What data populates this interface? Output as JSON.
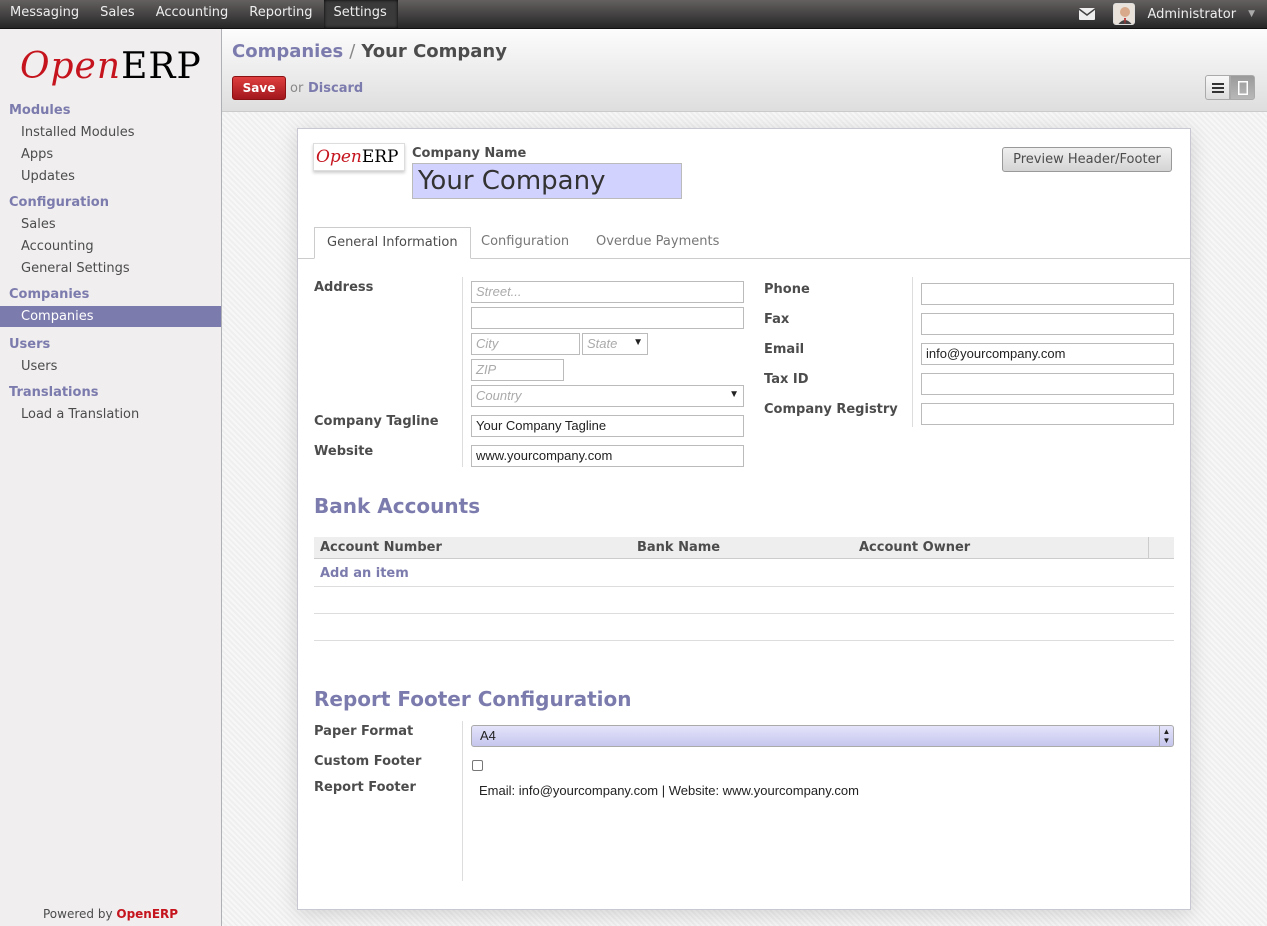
{
  "topbar": {
    "menu": [
      "Messaging",
      "Sales",
      "Accounting",
      "Reporting",
      "Settings"
    ],
    "active_menu": "Settings",
    "user": "Administrator"
  },
  "sidebar": {
    "powered_prefix": "Powered by ",
    "powered_brand": "OpenERP",
    "logo_open": "Open",
    "logo_erp": "ERP",
    "sections": [
      {
        "title": "Modules",
        "items": [
          "Installed Modules",
          "Apps",
          "Updates"
        ]
      },
      {
        "title": "Configuration",
        "items": [
          "Sales",
          "Accounting",
          "General Settings"
        ]
      },
      {
        "title": "Companies",
        "items": [
          "Companies"
        ]
      },
      {
        "title": "Users",
        "items": [
          "Users"
        ]
      },
      {
        "title": "Translations",
        "items": [
          "Load a Translation"
        ]
      }
    ]
  },
  "header": {
    "breadcrumb_parent": "Companies",
    "breadcrumb_sep": "/",
    "breadcrumb_current": "Your Company",
    "save_label": "Save",
    "or_text": "or",
    "discard_label": "Discard"
  },
  "form": {
    "company_name_label": "Company Name",
    "company_name_value": "Your Company",
    "preview_button": "Preview Header/Footer",
    "tabs": [
      "General Information",
      "Configuration",
      "Overdue Payments"
    ],
    "address_label": "Address",
    "street_placeholder": "Street...",
    "city_placeholder": "City",
    "state_placeholder": "State",
    "zip_placeholder": "ZIP",
    "country_placeholder": "Country",
    "tagline_label": "Company Tagline",
    "tagline_value": "Your Company Tagline",
    "website_label": "Website",
    "website_value": "www.yourcompany.com",
    "phone_label": "Phone",
    "fax_label": "Fax",
    "email_label": "Email",
    "email_value": "info@yourcompany.com",
    "taxid_label": "Tax ID",
    "registry_label": "Company Registry",
    "bank_title": "Bank Accounts",
    "bank_columns": [
      "Account Number",
      "Bank Name",
      "Account Owner"
    ],
    "add_item": "Add an item",
    "report_title": "Report Footer Configuration",
    "paper_format_label": "Paper Format",
    "paper_format_value": "A4",
    "custom_footer_label": "Custom Footer",
    "report_footer_label": "Report Footer",
    "report_footer_value": "Email: info@yourcompany.com | Website: www.yourcompany.com"
  }
}
